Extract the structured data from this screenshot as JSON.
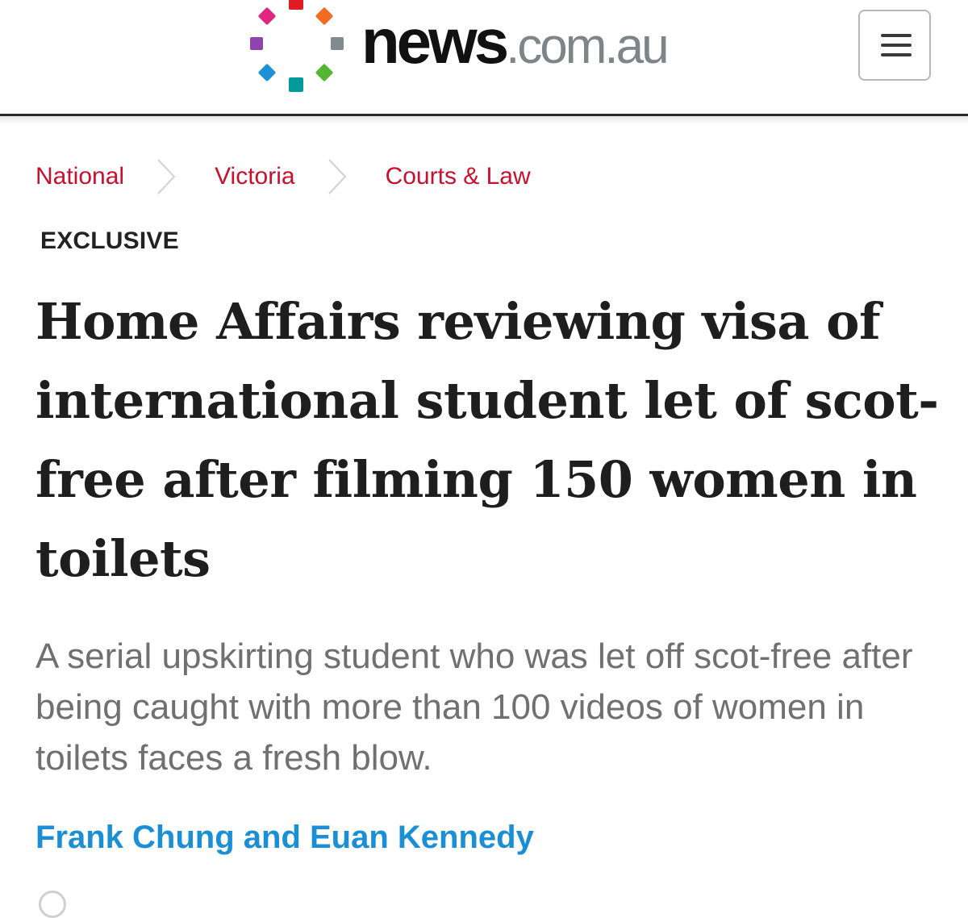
{
  "site": {
    "logo_primary": "news",
    "logo_secondary": ".com.au",
    "logo_dot_colors": [
      "#e01b22",
      "#f26b21",
      "#7e8b8f",
      "#57b534",
      "#009a9a",
      "#1e90d6",
      "#8e44ad",
      "#e0267e"
    ],
    "menu_icon": "hamburger-menu-icon"
  },
  "breadcrumb": {
    "items": [
      {
        "label": "National"
      },
      {
        "label": "Victoria"
      },
      {
        "label": "Courts & Law"
      }
    ],
    "separator_icon": "chevron-right-icon",
    "link_color": "#c8102e"
  },
  "article": {
    "kicker": "EXCLUSIVE",
    "headline": "Home Affairs reviewing visa of international student let of scot-free after filming 150 women in toilets",
    "standfirst": "A serial upskirting student who was let off scot-free after being caught with more than 100 videos of women in toilets faces a fresh blow.",
    "byline": "Frank Chung and Euan Kennedy",
    "byline_color": "#1b8fd6"
  }
}
